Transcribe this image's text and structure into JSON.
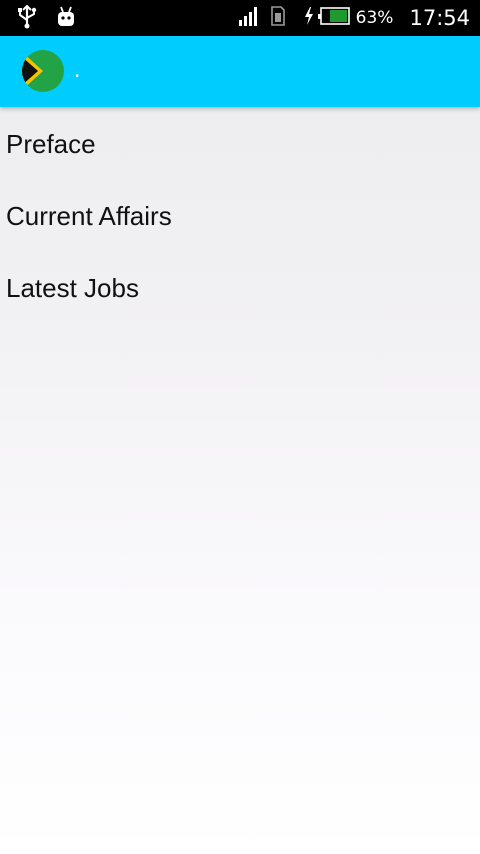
{
  "status_bar": {
    "battery_percent": "63%",
    "time": "17:54",
    "icons": [
      "usb-icon",
      "android-icon",
      "signal-icon",
      "sim-icon",
      "charging-icon",
      "battery-icon"
    ]
  },
  "toolbar": {
    "title": ".",
    "logo": "south-africa-flag-icon"
  },
  "menu": {
    "items": [
      {
        "label": "Preface"
      },
      {
        "label": "Current Affairs"
      },
      {
        "label": "Latest Jobs"
      }
    ]
  },
  "colors": {
    "toolbar_bg": "#00cdfe",
    "status_bar_bg": "#000000",
    "text": "#111111"
  }
}
